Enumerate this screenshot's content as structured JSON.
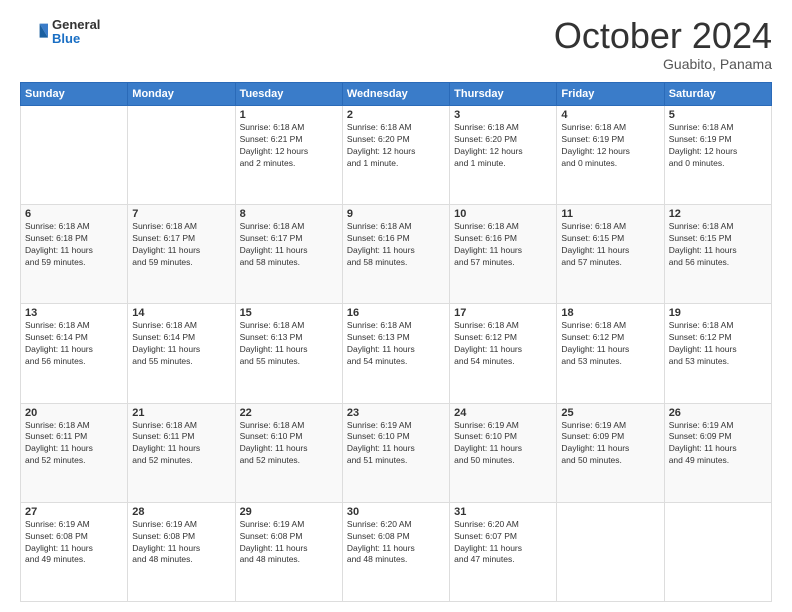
{
  "header": {
    "logo": {
      "general": "General",
      "blue": "Blue"
    },
    "title": "October 2024",
    "subtitle": "Guabito, Panama"
  },
  "weekdays": [
    "Sunday",
    "Monday",
    "Tuesday",
    "Wednesday",
    "Thursday",
    "Friday",
    "Saturday"
  ],
  "weeks": [
    [
      {
        "day": "",
        "info": ""
      },
      {
        "day": "",
        "info": ""
      },
      {
        "day": "1",
        "info": "Sunrise: 6:18 AM\nSunset: 6:21 PM\nDaylight: 12 hours\nand 2 minutes."
      },
      {
        "day": "2",
        "info": "Sunrise: 6:18 AM\nSunset: 6:20 PM\nDaylight: 12 hours\nand 1 minute."
      },
      {
        "day": "3",
        "info": "Sunrise: 6:18 AM\nSunset: 6:20 PM\nDaylight: 12 hours\nand 1 minute."
      },
      {
        "day": "4",
        "info": "Sunrise: 6:18 AM\nSunset: 6:19 PM\nDaylight: 12 hours\nand 0 minutes."
      },
      {
        "day": "5",
        "info": "Sunrise: 6:18 AM\nSunset: 6:19 PM\nDaylight: 12 hours\nand 0 minutes."
      }
    ],
    [
      {
        "day": "6",
        "info": "Sunrise: 6:18 AM\nSunset: 6:18 PM\nDaylight: 11 hours\nand 59 minutes."
      },
      {
        "day": "7",
        "info": "Sunrise: 6:18 AM\nSunset: 6:17 PM\nDaylight: 11 hours\nand 59 minutes."
      },
      {
        "day": "8",
        "info": "Sunrise: 6:18 AM\nSunset: 6:17 PM\nDaylight: 11 hours\nand 58 minutes."
      },
      {
        "day": "9",
        "info": "Sunrise: 6:18 AM\nSunset: 6:16 PM\nDaylight: 11 hours\nand 58 minutes."
      },
      {
        "day": "10",
        "info": "Sunrise: 6:18 AM\nSunset: 6:16 PM\nDaylight: 11 hours\nand 57 minutes."
      },
      {
        "day": "11",
        "info": "Sunrise: 6:18 AM\nSunset: 6:15 PM\nDaylight: 11 hours\nand 57 minutes."
      },
      {
        "day": "12",
        "info": "Sunrise: 6:18 AM\nSunset: 6:15 PM\nDaylight: 11 hours\nand 56 minutes."
      }
    ],
    [
      {
        "day": "13",
        "info": "Sunrise: 6:18 AM\nSunset: 6:14 PM\nDaylight: 11 hours\nand 56 minutes."
      },
      {
        "day": "14",
        "info": "Sunrise: 6:18 AM\nSunset: 6:14 PM\nDaylight: 11 hours\nand 55 minutes."
      },
      {
        "day": "15",
        "info": "Sunrise: 6:18 AM\nSunset: 6:13 PM\nDaylight: 11 hours\nand 55 minutes."
      },
      {
        "day": "16",
        "info": "Sunrise: 6:18 AM\nSunset: 6:13 PM\nDaylight: 11 hours\nand 54 minutes."
      },
      {
        "day": "17",
        "info": "Sunrise: 6:18 AM\nSunset: 6:12 PM\nDaylight: 11 hours\nand 54 minutes."
      },
      {
        "day": "18",
        "info": "Sunrise: 6:18 AM\nSunset: 6:12 PM\nDaylight: 11 hours\nand 53 minutes."
      },
      {
        "day": "19",
        "info": "Sunrise: 6:18 AM\nSunset: 6:12 PM\nDaylight: 11 hours\nand 53 minutes."
      }
    ],
    [
      {
        "day": "20",
        "info": "Sunrise: 6:18 AM\nSunset: 6:11 PM\nDaylight: 11 hours\nand 52 minutes."
      },
      {
        "day": "21",
        "info": "Sunrise: 6:18 AM\nSunset: 6:11 PM\nDaylight: 11 hours\nand 52 minutes."
      },
      {
        "day": "22",
        "info": "Sunrise: 6:18 AM\nSunset: 6:10 PM\nDaylight: 11 hours\nand 52 minutes."
      },
      {
        "day": "23",
        "info": "Sunrise: 6:19 AM\nSunset: 6:10 PM\nDaylight: 11 hours\nand 51 minutes."
      },
      {
        "day": "24",
        "info": "Sunrise: 6:19 AM\nSunset: 6:10 PM\nDaylight: 11 hours\nand 50 minutes."
      },
      {
        "day": "25",
        "info": "Sunrise: 6:19 AM\nSunset: 6:09 PM\nDaylight: 11 hours\nand 50 minutes."
      },
      {
        "day": "26",
        "info": "Sunrise: 6:19 AM\nSunset: 6:09 PM\nDaylight: 11 hours\nand 49 minutes."
      }
    ],
    [
      {
        "day": "27",
        "info": "Sunrise: 6:19 AM\nSunset: 6:08 PM\nDaylight: 11 hours\nand 49 minutes."
      },
      {
        "day": "28",
        "info": "Sunrise: 6:19 AM\nSunset: 6:08 PM\nDaylight: 11 hours\nand 48 minutes."
      },
      {
        "day": "29",
        "info": "Sunrise: 6:19 AM\nSunset: 6:08 PM\nDaylight: 11 hours\nand 48 minutes."
      },
      {
        "day": "30",
        "info": "Sunrise: 6:20 AM\nSunset: 6:08 PM\nDaylight: 11 hours\nand 48 minutes."
      },
      {
        "day": "31",
        "info": "Sunrise: 6:20 AM\nSunset: 6:07 PM\nDaylight: 11 hours\nand 47 minutes."
      },
      {
        "day": "",
        "info": ""
      },
      {
        "day": "",
        "info": ""
      }
    ]
  ]
}
